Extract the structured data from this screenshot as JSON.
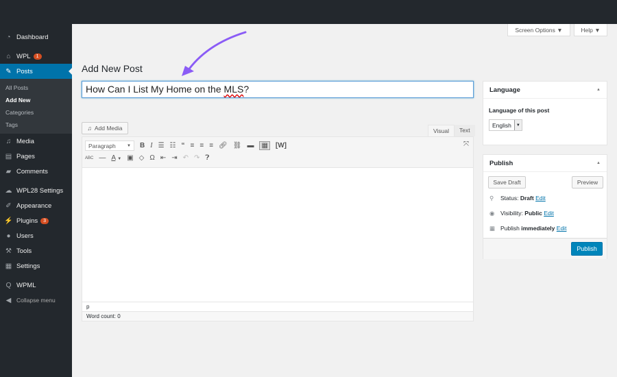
{
  "sidebar": {
    "items": [
      {
        "label": "Dashboard",
        "icon": "dashboard-icon"
      },
      {
        "label": "WPL",
        "icon": "wpl-icon",
        "badge": "1"
      },
      {
        "label": "Posts",
        "icon": "pin-icon"
      },
      {
        "label": "Media",
        "icon": "media-icon"
      },
      {
        "label": "Pages",
        "icon": "pages-icon"
      },
      {
        "label": "Comments",
        "icon": "comments-icon"
      },
      {
        "label": "WPL28 Settings",
        "icon": "settings-cloud-icon"
      },
      {
        "label": "Appearance",
        "icon": "brush-icon"
      },
      {
        "label": "Plugins",
        "icon": "plugin-icon",
        "badge": "3"
      },
      {
        "label": "Users",
        "icon": "user-icon"
      },
      {
        "label": "Tools",
        "icon": "wrench-icon"
      },
      {
        "label": "Settings",
        "icon": "sliders-icon"
      },
      {
        "label": "WPML",
        "icon": "wpml-icon"
      },
      {
        "label": "Collapse menu",
        "icon": "collapse-icon"
      }
    ],
    "submenu": [
      "All Posts",
      "Add New",
      "Categories",
      "Tags"
    ]
  },
  "header": {
    "screen_options": "Screen Options ▼",
    "help": "Help ▼"
  },
  "main": {
    "title": "Add New Post",
    "post_title_prefix": "How Can I List My Home on the ",
    "post_title_misspelled": "MLS",
    "post_title_suffix": "?",
    "add_media": "Add Media",
    "tab_visual": "Visual",
    "tab_text": "Text",
    "format_select": "Paragraph",
    "path": "p",
    "word_count": "Word count: 0"
  },
  "language_box": {
    "title": "Language",
    "label": "Language of this post",
    "value": "English"
  },
  "publish_box": {
    "title": "Publish",
    "save_draft": "Save Draft",
    "preview": "Preview",
    "status_label": "Status: ",
    "status_value": "Draft",
    "visibility_label": "Visibility: ",
    "visibility_value": "Public",
    "publish_label": "Publish ",
    "publish_value": "immediately",
    "edit": "Edit",
    "publish_button": "Publish"
  },
  "colors": {
    "accent": "#0073aa",
    "sidebar": "#23282d",
    "arrow": "#8b5cf6"
  }
}
